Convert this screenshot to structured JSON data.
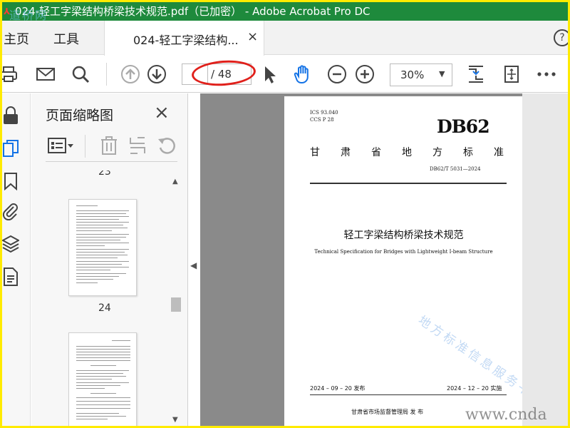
{
  "window": {
    "title": "024-轻工字梁结构桥梁技术规范.pdf（已加密） - Adobe Acrobat Pro DC",
    "watermark": "道桥网"
  },
  "tabs": {
    "home": "主页",
    "tools": "工具",
    "document": "024-轻工字梁结构...",
    "close": "×",
    "help": "?"
  },
  "toolbar": {
    "page_current": "",
    "page_total": "/ 48",
    "zoom": "30%"
  },
  "thumbnails": {
    "title": "页面缩略图",
    "close": "×",
    "pages": [
      {
        "number": "23"
      },
      {
        "number": "24"
      }
    ]
  },
  "document": {
    "ics": "ICS  93.040",
    "ccs": "CCS  P 28",
    "db_code": "DB62",
    "standard_title_chars": [
      "甘",
      "肃",
      "省",
      "地",
      "方",
      "标",
      "准"
    ],
    "standard_no": "DB62/T 5031—2024",
    "name_cn": "轻工字梁结构桥梁技术规范",
    "name_en": "Technical Specification for Bridges with Lightweight I-beam Structure",
    "watermark": "地方标准信息服务平台",
    "issue_date": "2024 – 09 – 20 发布",
    "implement_date": "2024 – 12 – 20 实施",
    "publisher": "甘肃省市场监督管理局     发 布"
  },
  "site_watermark": "www.cnda",
  "colors": {
    "titlebar": "#1e8a3c",
    "frame": "#ffeb00",
    "accent_blue": "#1473e6",
    "annotation_red": "#e0201b"
  }
}
